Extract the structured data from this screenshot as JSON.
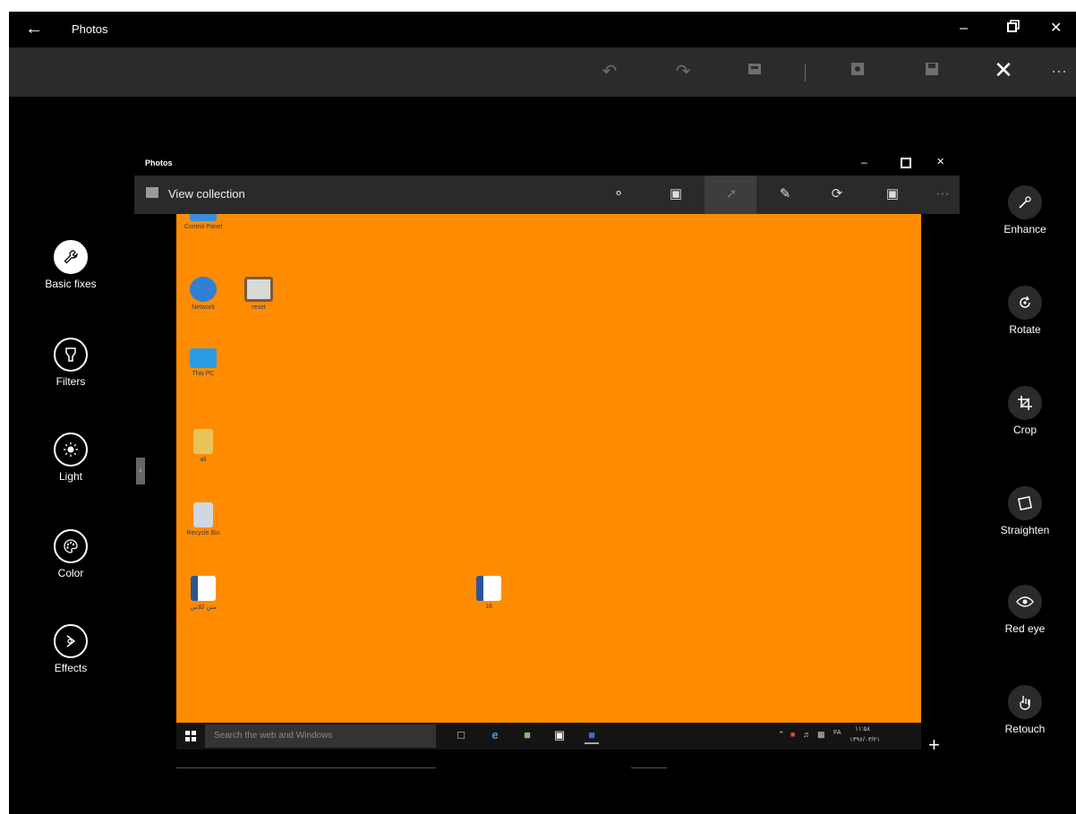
{
  "app": {
    "title": "Photos",
    "back_icon": "back-arrow-icon",
    "window_controls": [
      "minimize",
      "restore",
      "close"
    ]
  },
  "toolbar": {
    "icons": [
      "undo-icon",
      "redo-icon",
      "save-copy-icon",
      "compare-icon",
      "save-icon",
      "close-icon",
      "more-icon"
    ]
  },
  "left_tools": [
    {
      "label": "Basic fixes",
      "icon": "wrench-icon",
      "selected": true
    },
    {
      "label": "Filters",
      "icon": "filter-icon"
    },
    {
      "label": "Light",
      "icon": "sun-icon"
    },
    {
      "label": "Color",
      "icon": "palette-icon"
    },
    {
      "label": "Effects",
      "icon": "effects-icon"
    }
  ],
  "right_tools": [
    {
      "label": "Enhance",
      "icon": "magic-wand-icon"
    },
    {
      "label": "Rotate",
      "icon": "rotate-icon"
    },
    {
      "label": "Crop",
      "icon": "crop-icon"
    },
    {
      "label": "Straighten",
      "icon": "straighten-icon"
    },
    {
      "label": "Red eye",
      "icon": "eye-icon"
    },
    {
      "label": "Retouch",
      "icon": "retouch-icon"
    }
  ],
  "photo": {
    "inner_window_title": "Photos",
    "view_collection": "View collection",
    "inner_toolbar_icons": [
      "share-icon",
      "slideshow-icon",
      "enhance-icon",
      "edit-icon",
      "rotate-icon",
      "delete-icon",
      "more-icon"
    ],
    "desktop_icons": [
      {
        "label": "Control Panel"
      },
      {
        "label": "Network"
      },
      {
        "label": "reset"
      },
      {
        "label": "This PC"
      },
      {
        "label": "ali"
      },
      {
        "label": "Recycle Bin"
      },
      {
        "label": "متن کلاس"
      },
      {
        "label": "16"
      }
    ],
    "taskbar": {
      "search_placeholder": "Search the web and Windows",
      "clock_time": "۱۱:۵۸",
      "clock_date": "۱۳۹۶/۰۳/۲۱",
      "lang": "FA"
    }
  },
  "colors": {
    "background": "#000000",
    "toolbar": "#2b2b2b",
    "canvas": "#ff8c00"
  }
}
